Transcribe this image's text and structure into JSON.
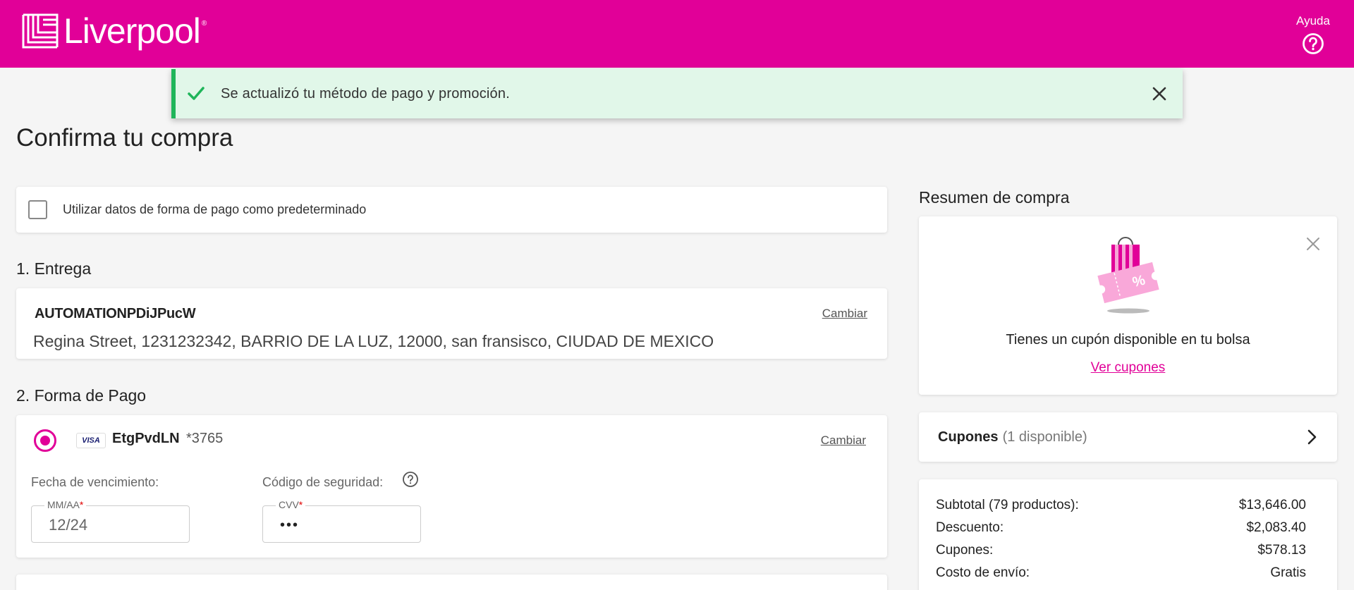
{
  "header": {
    "brand": "Liverpool",
    "brand_mark": "®",
    "help_label": "Ayuda",
    "help_icon": "question-circle-icon",
    "bg_color": "#e10098"
  },
  "toast": {
    "message": "Se actualizó tu método de pago y promoción.",
    "icon": "check-icon",
    "close_icon": "close-icon",
    "bg_color": "#e1f7e9",
    "accent_color": "#1fb55a"
  },
  "page": {
    "title": "Confirma tu compra"
  },
  "default_payment": {
    "label": "Utilizar datos de forma de pago como predeterminado",
    "checked": false
  },
  "entrega": {
    "section_title": "1. Entrega",
    "name": "AUTOMATIONPDiJPucW",
    "address": "Regina Street, 1231232342, BARRIO DE LA LUZ, 12000, san fransisco, CIUDAD DE MEXICO",
    "change_label": "Cambiar"
  },
  "pago": {
    "section_title": "2. Forma de Pago",
    "card_brand": "VISA",
    "card_holder": "EtgPvdLN",
    "card_last4": "*3765",
    "change_label": "Cambiar",
    "expiry_label": "Fecha de vencimiento:",
    "expiry_legend": "MM/AA",
    "expiry_value": "12/24",
    "security_label": "Código de seguridad:",
    "cvv_legend": "CVV",
    "cvv_value": "•••",
    "required_mark": "*"
  },
  "summary": {
    "title": "Resumen de compra",
    "promo_text": "Tienes un cupón disponible en tu bolsa",
    "promo_link": "Ver cupones",
    "promo_percent": "%",
    "cupones_label": "Cupones",
    "cupones_count": "(1 disponible)",
    "rows": [
      {
        "label": "Subtotal (79 productos):",
        "value": "$13,646.00"
      },
      {
        "label": "Descuento:",
        "value": "$2,083.40"
      },
      {
        "label": "Cupones:",
        "value": "$578.13"
      },
      {
        "label": "Costo de envío:",
        "value": "Gratis"
      }
    ]
  }
}
